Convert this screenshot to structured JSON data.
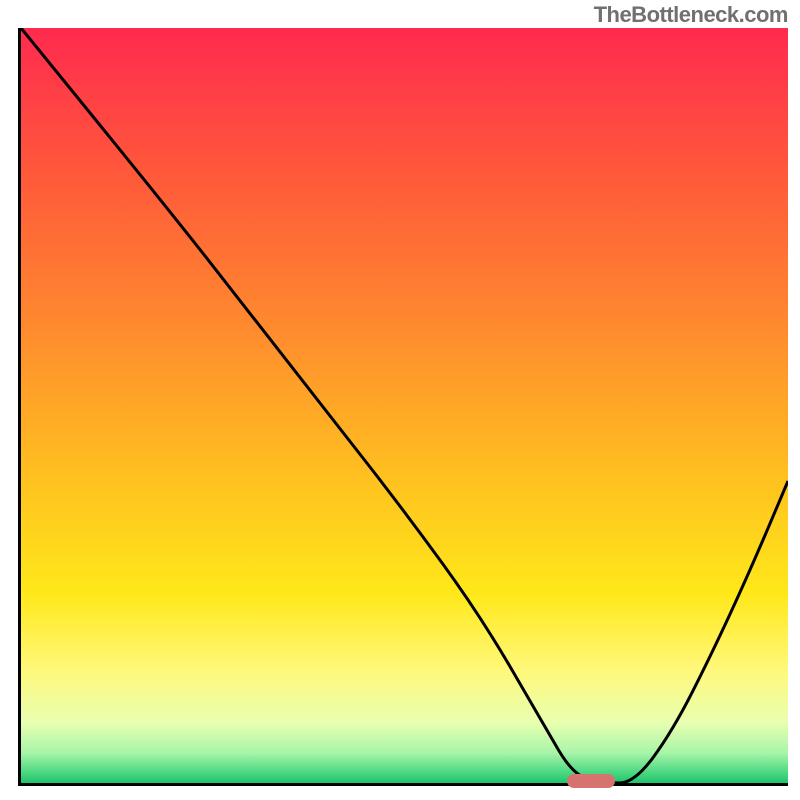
{
  "watermark": "TheBottleneck.com",
  "chart_data": {
    "type": "line",
    "title": "",
    "xlabel": "",
    "ylabel": "",
    "xlim": [
      0,
      100
    ],
    "ylim": [
      0,
      100
    ],
    "series": [
      {
        "name": "bottleneck-curve",
        "x": [
          0,
          20,
          30,
          40,
          50,
          60,
          68,
          72,
          76,
          80,
          85,
          90,
          95,
          100
        ],
        "values": [
          100,
          75,
          62,
          49,
          36,
          22,
          8,
          1,
          0,
          0,
          7,
          17,
          28,
          40
        ]
      }
    ],
    "marker": {
      "x": 74,
      "y": 0,
      "color": "#d7736f"
    },
    "gradient_stops": [
      {
        "offset": 0.0,
        "color": "#ff2a4f"
      },
      {
        "offset": 0.2,
        "color": "#ff5a3a"
      },
      {
        "offset": 0.4,
        "color": "#ff8b2e"
      },
      {
        "offset": 0.6,
        "color": "#ffc21f"
      },
      {
        "offset": 0.75,
        "color": "#ffe81a"
      },
      {
        "offset": 0.85,
        "color": "#fff87a"
      },
      {
        "offset": 0.92,
        "color": "#e8ffb0"
      },
      {
        "offset": 0.96,
        "color": "#a8f5a8"
      },
      {
        "offset": 0.985,
        "color": "#4fd984"
      },
      {
        "offset": 1.0,
        "color": "#1fc46a"
      }
    ]
  }
}
